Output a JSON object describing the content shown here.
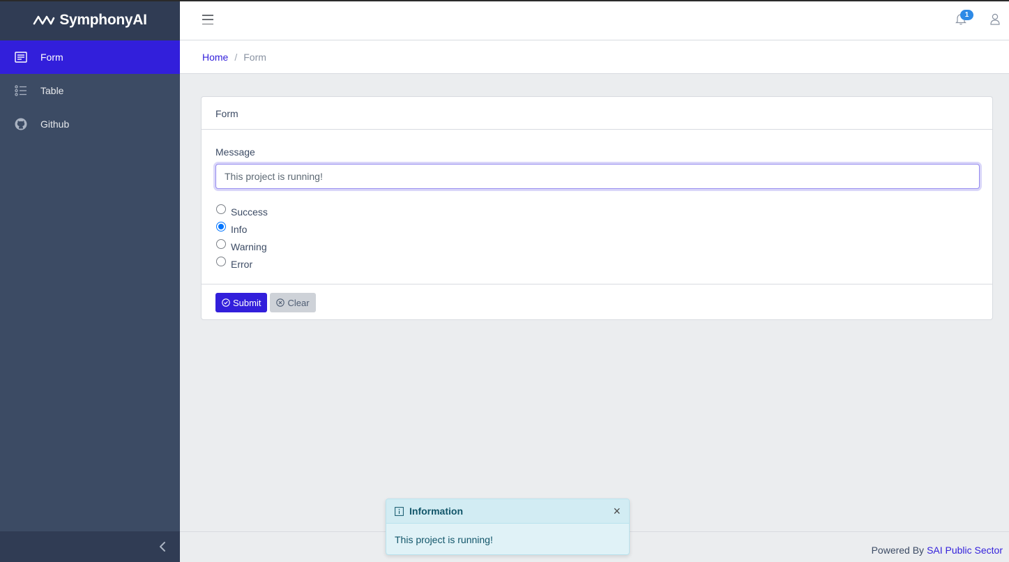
{
  "brand": {
    "name": "SymphonyAI"
  },
  "sidebar": {
    "items": [
      {
        "label": "Form",
        "icon": "form-icon",
        "active": true
      },
      {
        "label": "Table",
        "icon": "list-icon",
        "active": false
      },
      {
        "label": "Github",
        "icon": "github-icon",
        "active": false
      }
    ]
  },
  "header": {
    "notification_count": "1"
  },
  "breadcrumb": {
    "home": "Home",
    "separator": "/",
    "current": "Form"
  },
  "card": {
    "title": "Form",
    "message_label": "Message",
    "message_value": "This project is running!",
    "radios": [
      {
        "label": "Success",
        "checked": false
      },
      {
        "label": "Info",
        "checked": true
      },
      {
        "label": "Warning",
        "checked": false
      },
      {
        "label": "Error",
        "checked": false
      }
    ],
    "submit_label": "Submit",
    "clear_label": "Clear"
  },
  "footer": {
    "prefix": "Powered By",
    "link": "SAI Public Sector"
  },
  "toast": {
    "title": "Information",
    "body": "This project is running!",
    "close": "×"
  },
  "colors": {
    "sidebar_bg": "#3c4b64",
    "primary": "#321fdb",
    "info_toast_bg": "#e0f2f7",
    "page_bg": "#ebedef"
  }
}
